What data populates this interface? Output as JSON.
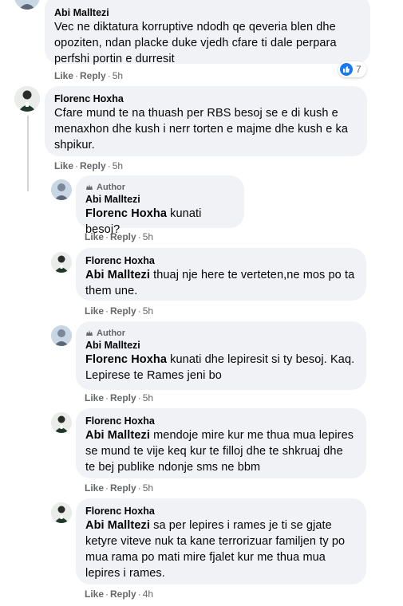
{
  "comments": [
    {
      "author": "Abi Malltezi",
      "lines": [
        "Vec ne diktatura korruptive ndodh qe qeveria blen dhe",
        "opoziten, ndan placke duke vjedh cfare ti dale perpara",
        "perfshi portin e durresit"
      ],
      "like": "Like",
      "reply": "Reply",
      "time": "5h",
      "reaction_count": "7"
    },
    {
      "author": "Florenc Hoxha",
      "lines": [
        "Cfare mund te na thuash per RBS besoj se e di kush e",
        "menaxhon dhe kush i nerr torten e majme dhe kush e ka",
        "shpikur."
      ],
      "like": "Like",
      "reply": "Reply",
      "time": "5h"
    },
    {
      "badge": "Author",
      "author": "Abi Malltezi",
      "mention": "Florenc Hoxha",
      "lines": [
        " kunati besoj?"
      ],
      "like": "Like",
      "reply": "Reply",
      "time": "5h"
    },
    {
      "author": "Florenc Hoxha",
      "mention": "Abi Malltezi",
      "lines": [
        " thuaj nje here te verteten,ne mos po ta",
        "them une."
      ],
      "like": "Like",
      "reply": "Reply",
      "time": "5h"
    },
    {
      "badge": "Author",
      "author": "Abi Malltezi",
      "mention": "Florenc Hoxha",
      "lines": [
        " kunati dhe lepiresit si ty besoj. Kaq.",
        "Lepirese te Rames jeni bo"
      ],
      "like": "Like",
      "reply": "Reply",
      "time": "5h"
    },
    {
      "author": "Florenc Hoxha",
      "mention": "Abi Malltezi",
      "lines": [
        " mendoje mire kur me thua mua lepires",
        "se mund te vije keq kur te filloj dhe te shkruaj dhe",
        "te bej publike ndonje sms ne bbm"
      ],
      "like": "Like",
      "reply": "Reply",
      "time": "5h"
    },
    {
      "author": "Florenc Hoxha",
      "mention": "Abi Malltezi",
      "lines": [
        " sa per lepires i rames je ti se gjate",
        "ketyre viteve nuk ta kane terrorizuar familjen ty po",
        "mua rama po mati mire fjalet kur me thua mua",
        "lepires i rames."
      ],
      "like": "Like",
      "reply": "Reply",
      "time": "4h"
    }
  ],
  "separator": "·",
  "colors": {
    "bubble": "#f0f2f5",
    "meta": "#65676b",
    "like": "#1877f2"
  }
}
